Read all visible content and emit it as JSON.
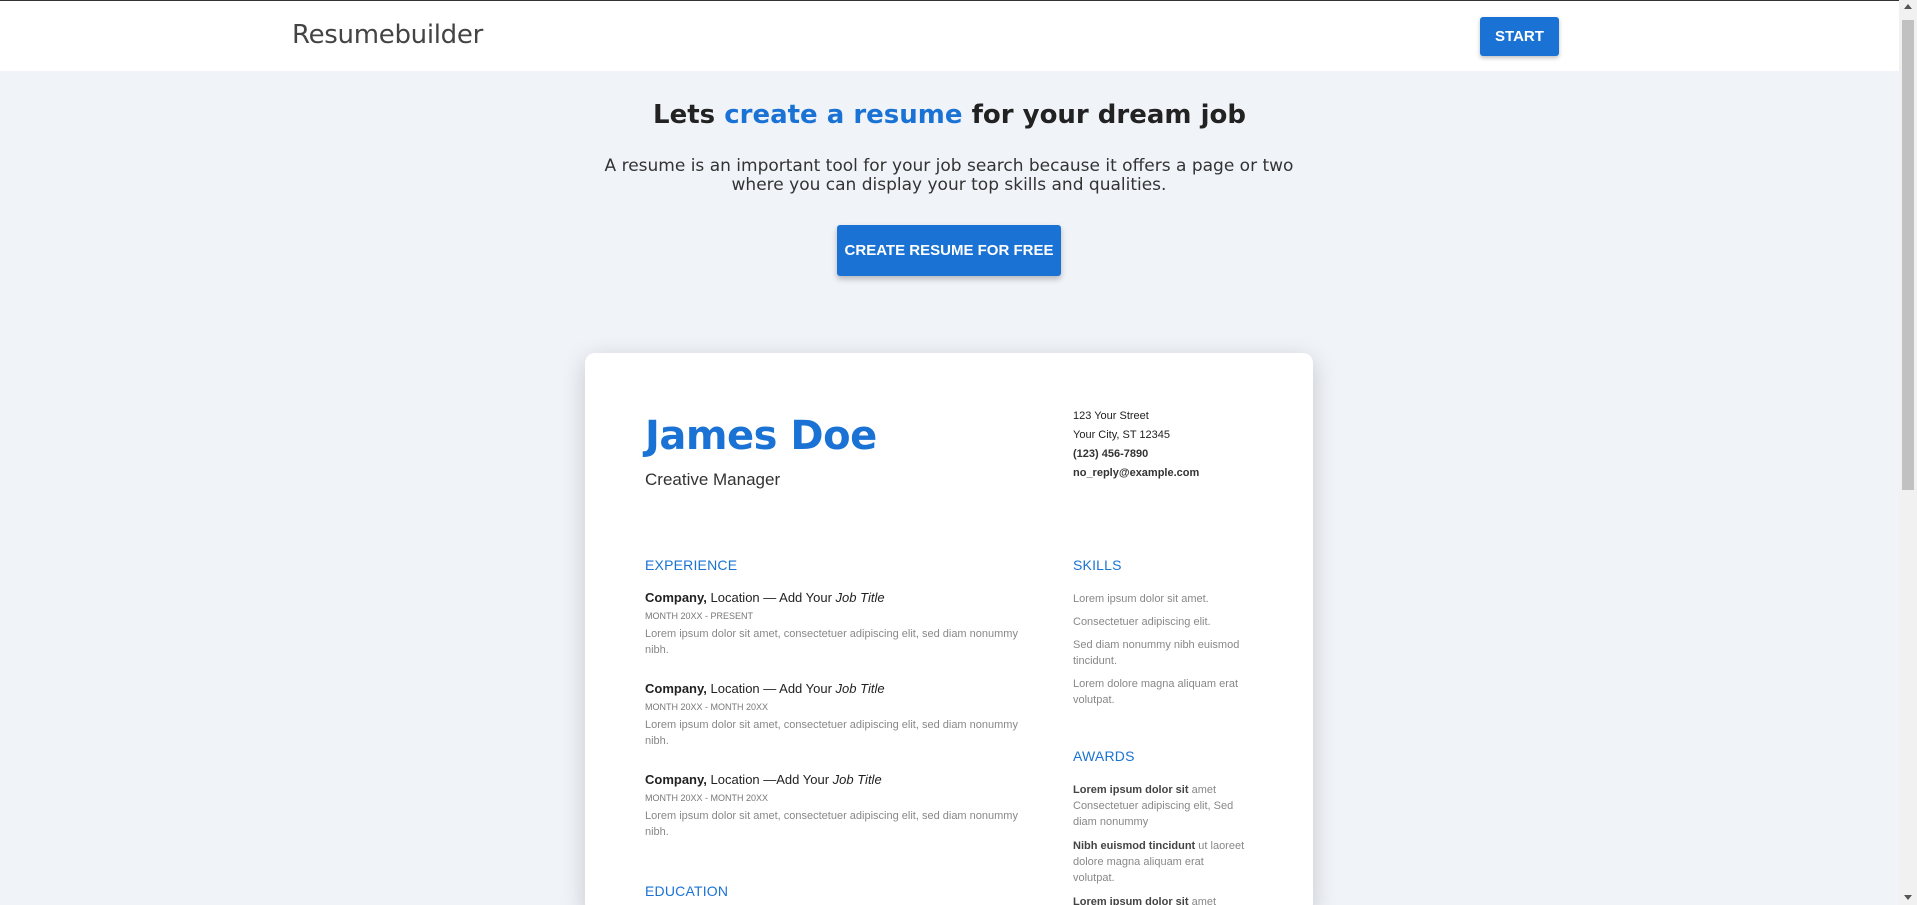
{
  "navbar": {
    "brand": "Resumebuilder",
    "start_label": "START"
  },
  "hero": {
    "title_prefix": "Lets ",
    "title_highlight": "create a resume",
    "title_suffix": " for your dream job",
    "subtitle": "A resume is an important tool for your job search because it offers a page or two where you can display your top skills and qualities.",
    "cta_label": "CREATE RESUME FOR FREE"
  },
  "resume": {
    "name": "James Doe",
    "role": "Creative Manager",
    "contact": {
      "street": "123 Your Street",
      "city": "Your City, ST 12345",
      "phone": "(123) 456-7890",
      "email": "no_reply@example.com"
    },
    "experience_heading": "EXPERIENCE",
    "experience": [
      {
        "company": "Company,",
        "location": " Location — Add Your ",
        "job": "Job Title",
        "dates": "MONTH 20XX - PRESENT",
        "desc": "Lorem ipsum dolor sit amet, consectetuer adipiscing elit, sed diam nonummy nibh."
      },
      {
        "company": "Company,",
        "location": " Location — Add Your ",
        "job": "Job Title",
        "dates": "MONTH 20XX - MONTH 20XX",
        "desc": "Lorem ipsum dolor sit amet, consectetuer adipiscing elit, sed diam nonummy nibh."
      },
      {
        "company": "Company,",
        "location": " Location —Add Your ",
        "job": "Job Title",
        "dates": "MONTH 20XX - MONTH 20XX",
        "desc": "Lorem ipsum dolor sit amet, consectetuer adipiscing elit, sed diam nonummy nibh."
      }
    ],
    "education_heading": "EDUCATION",
    "skills_heading": "SKILLS",
    "skills": [
      "Lorem ipsum dolor sit amet.",
      "Consectetuer adipiscing elit.",
      "Sed diam nonummy nibh euismod tincidunt.",
      "Lorem dolore magna aliquam erat volutpat."
    ],
    "awards_heading": "AWARDS",
    "awards": [
      {
        "bold": "Lorem ipsum dolor sit",
        "rest": " amet Consectetuer adipiscing elit, Sed diam nonummy"
      },
      {
        "bold": "Nibh euismod tincidunt",
        "rest": " ut laoreet dolore magna aliquam erat volutpat."
      },
      {
        "bold": "Lorem ipsum dolor sit",
        "rest": " amet"
      }
    ]
  }
}
